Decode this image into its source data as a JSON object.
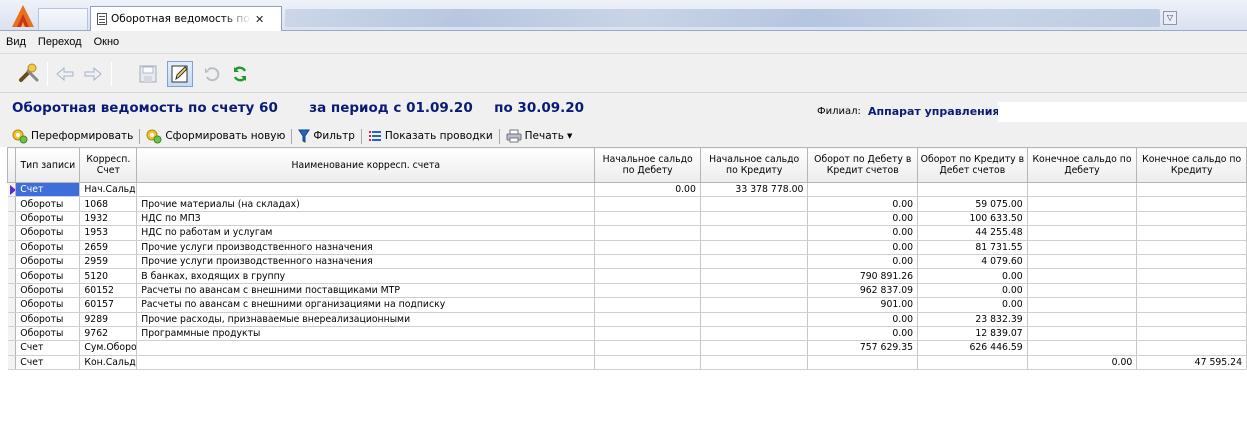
{
  "tab": {
    "title": "Оборотная ведомость по"
  },
  "menu": {
    "items": [
      "Вид",
      "Переход",
      "Окно"
    ]
  },
  "header": {
    "title": "Оборотная ведомость по счету 60",
    "period": "за период с 01.09.20",
    "period_end": "по 30.09.20",
    "filial_label": "Филиал:",
    "filial_value": "Аппарат управления"
  },
  "actions": {
    "reform": "Переформировать",
    "new": "Сформировать новую",
    "filter": "Фильтр",
    "show_entries": "Показать проводки",
    "print": "Печать"
  },
  "colors": {
    "title": "#0a1a78",
    "selection": "#3d6ed9"
  },
  "table": {
    "columns": [
      "Тип записи",
      "Корресп. Счет",
      "Наименование корресп. счета",
      "Начальное сальдо по Дебету",
      "Начальное сальдо по Кредиту",
      "Оборот по Дебету в Кредит счетов",
      "Оборот по Кредиту в Дебет счетов",
      "Конечное сальдо по Дебету",
      "Конечное сальдо по Кредиту"
    ],
    "rows": [
      [
        "Счет",
        "Нач.Сальдо",
        "",
        "0.00",
        "33 378 778.00",
        "",
        "",
        "",
        ""
      ],
      [
        "Обороты",
        "1068",
        "Прочие материалы (на складах)",
        "",
        "",
        "0.00",
        "59 075.00",
        "",
        ""
      ],
      [
        "Обороты",
        "1932",
        "НДС по МПЗ",
        "",
        "",
        "0.00",
        "100 633.50",
        "",
        ""
      ],
      [
        "Обороты",
        "1953",
        "НДС по работам и услугам",
        "",
        "",
        "0.00",
        "44 255.48",
        "",
        ""
      ],
      [
        "Обороты",
        "2659",
        "Прочие услуги производственного назначения",
        "",
        "",
        "0.00",
        "81 731.55",
        "",
        ""
      ],
      [
        "Обороты",
        "2959",
        "Прочие услуги производственного назначения",
        "",
        "",
        "0.00",
        "4 079.60",
        "",
        ""
      ],
      [
        "Обороты",
        "5120",
        "В банках, входящих в группу",
        "",
        "",
        "790 891.26",
        "0.00",
        "",
        ""
      ],
      [
        "Обороты",
        "60152",
        "Расчеты по авансам с внешними поставщиками МТР",
        "",
        "",
        "962 837.09",
        "0.00",
        "",
        ""
      ],
      [
        "Обороты",
        "60157",
        "Расчеты по авансам с внешними организациями на подписку",
        "",
        "",
        "901.00",
        "0.00",
        "",
        ""
      ],
      [
        "Обороты",
        "9289",
        "Прочие расходы, признаваемые внереализационными",
        "",
        "",
        "0.00",
        "23 832.39",
        "",
        ""
      ],
      [
        "Обороты",
        "9762",
        "Программные продукты",
        "",
        "",
        "0.00",
        "12 839.07",
        "",
        ""
      ],
      [
        "Счет",
        "Сум.Обороты",
        "",
        "",
        "",
        "757 629.35",
        "626 446.59",
        "",
        ""
      ],
      [
        "Счет",
        "Кон.Сальдо",
        "",
        "",
        "",
        "",
        "",
        "0.00",
        "47 595.24"
      ]
    ]
  }
}
